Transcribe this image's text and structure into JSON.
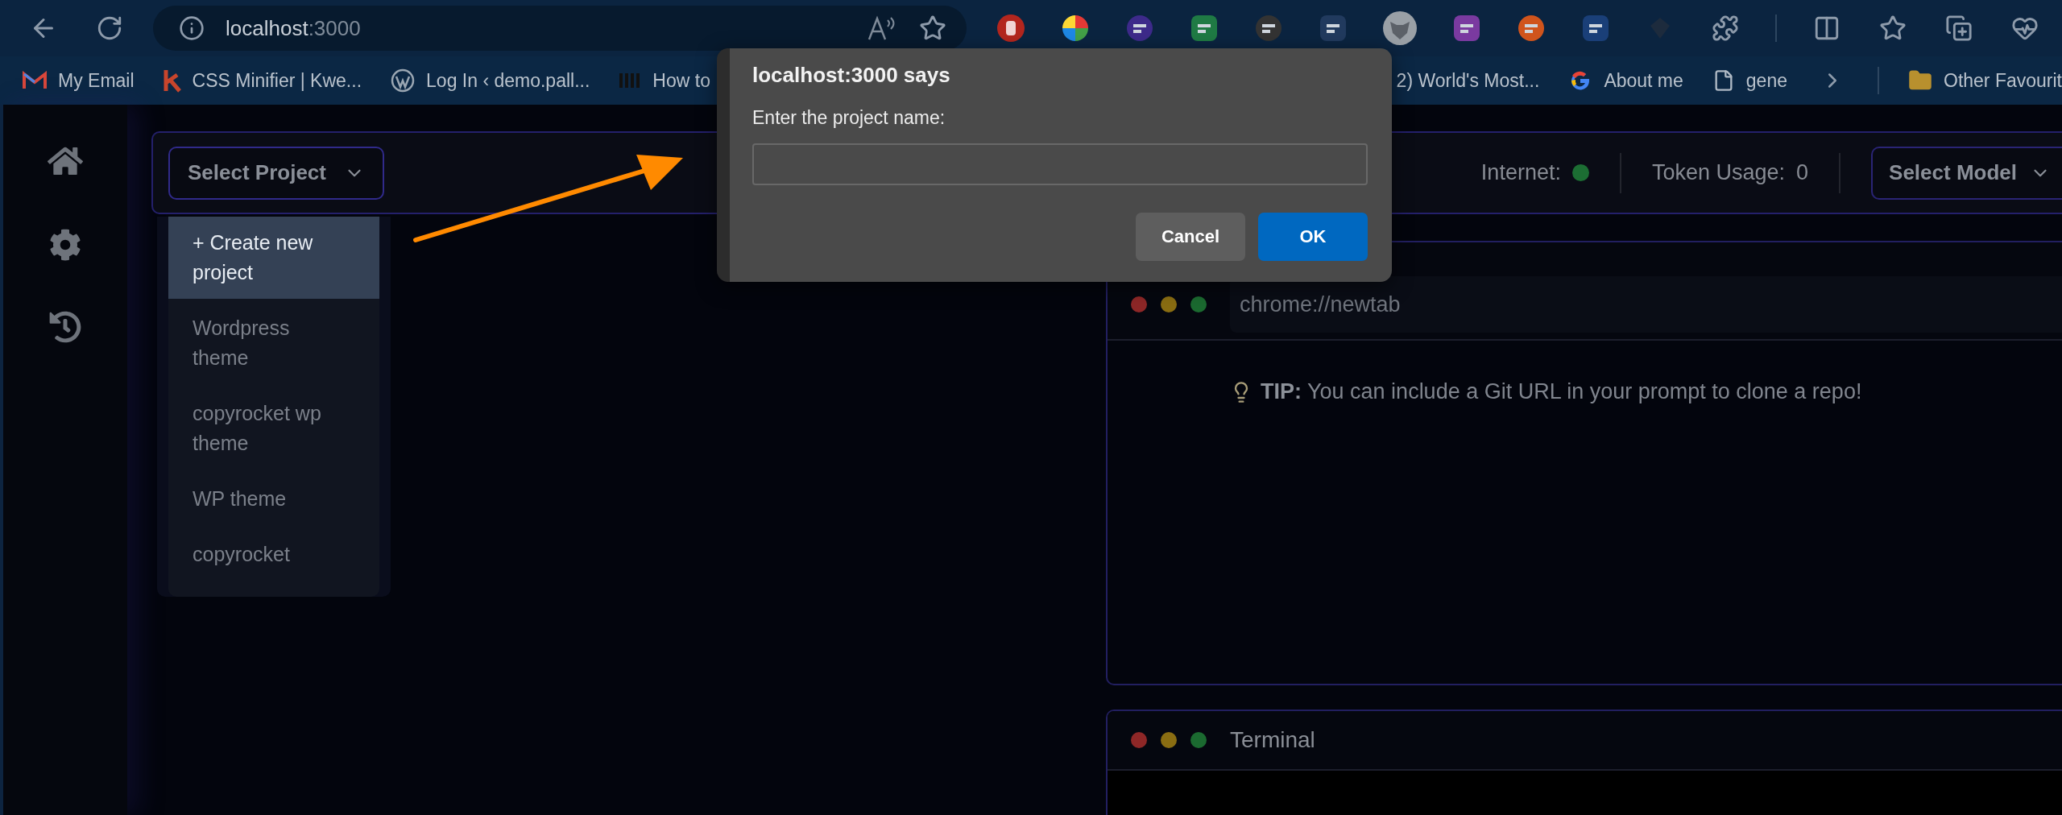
{
  "browser": {
    "address": {
      "host": "localhost",
      "port": ":3000"
    }
  },
  "bookmarks": [
    {
      "label": "My Email",
      "kind": "mail"
    },
    {
      "label": "CSS Minifier | Kwe...",
      "kind": "k"
    },
    {
      "label": "Log In ‹ demo.pall...",
      "kind": "wordpress"
    },
    {
      "label": "How to",
      "kind": "bars"
    },
    {
      "label": "2) World's Most...",
      "kind": "none"
    },
    {
      "label": "About me",
      "kind": "google"
    },
    {
      "label": "gene",
      "kind": "page"
    }
  ],
  "other_bookmarks": {
    "label": "Other Favourit"
  },
  "project_select": {
    "label": "Select Project",
    "expanded": true
  },
  "project_menu": [
    {
      "label": "+ Create new project",
      "selected": true
    },
    {
      "label": "Wordpress theme",
      "selected": false
    },
    {
      "label": "copyrocket wp theme",
      "selected": false
    },
    {
      "label": "WP theme",
      "selected": false
    },
    {
      "label": "copyrocket",
      "selected": false
    }
  ],
  "internet": {
    "label": "Internet:",
    "online": true
  },
  "token_usage": {
    "label": "Token Usage:",
    "value": "0"
  },
  "model_select": {
    "label": "Select Model"
  },
  "browser_panel": {
    "url": "chrome://newtab",
    "tip": "**TIP:** You can include a Git URL in your prompt to clone a repo!"
  },
  "terminal": {
    "title": "Terminal"
  },
  "dialog": {
    "title": "localhost:3000 says",
    "message": "Enter the project name:",
    "buttons": [
      {
        "label": "Cancel",
        "kind": "secondary"
      },
      {
        "label": "OK",
        "kind": "primary"
      }
    ]
  }
}
